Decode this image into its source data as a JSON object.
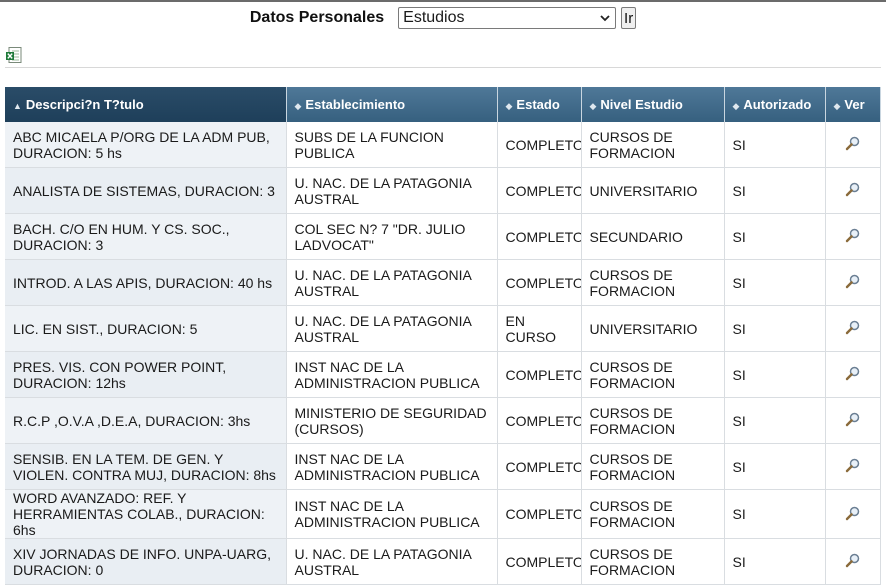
{
  "toolbar": {
    "label": "Datos Personales",
    "select_value": "Estudios",
    "go_label": "Ir"
  },
  "icons": {
    "export": "excel-icon",
    "view": "magnifier-icon",
    "dropdown": "chevron-down-icon",
    "sort": "sort-arrow-icon"
  },
  "colors": {
    "header_bg": "#3d6686",
    "header_active_bg": "#234560",
    "first_col_bg": "#e9eef3"
  },
  "table": {
    "columns": [
      {
        "label": "Descripci?n T?tulo",
        "sort": "▲"
      },
      {
        "label": "Establecimiento",
        "sort": "◆"
      },
      {
        "label": "Estado",
        "sort": "◆"
      },
      {
        "label": "Nivel Estudio",
        "sort": "◆"
      },
      {
        "label": "Autorizado",
        "sort": "◆"
      },
      {
        "label": "Ver",
        "sort": "◆"
      }
    ],
    "rows": [
      {
        "descripcion": "ABC MICAELA P/ORG DE LA ADM PUB, DURACION: 5 hs",
        "establecimiento": "SUBS DE LA FUNCION PUBLICA",
        "estado": "COMPLETO",
        "nivel": "CURSOS DE FORMACION",
        "autorizado": "SI"
      },
      {
        "descripcion": "ANALISTA DE SISTEMAS, DURACION: 3",
        "establecimiento": "U. NAC. DE LA PATAGONIA AUSTRAL",
        "estado": "COMPLETO",
        "nivel": "UNIVERSITARIO",
        "autorizado": "SI"
      },
      {
        "descripcion": "BACH. C/O EN HUM. Y CS. SOC., DURACION: 3",
        "establecimiento": "COL SEC N? 7 \"DR. JULIO LADVOCAT\"",
        "estado": "COMPLETO",
        "nivel": "SECUNDARIO",
        "autorizado": "SI"
      },
      {
        "descripcion": "INTROD. A LAS APIS, DURACION: 40 hs",
        "establecimiento": "U. NAC. DE LA PATAGONIA AUSTRAL",
        "estado": "COMPLETO",
        "nivel": "CURSOS DE FORMACION",
        "autorizado": "SI"
      },
      {
        "descripcion": "LIC. EN SIST., DURACION: 5",
        "establecimiento": "U. NAC. DE LA PATAGONIA AUSTRAL",
        "estado": "EN CURSO",
        "nivel": "UNIVERSITARIO",
        "autorizado": "SI"
      },
      {
        "descripcion": "PRES. VIS. CON POWER POINT, DURACION: 12hs",
        "establecimiento": "INST NAC DE LA ADMINISTRACION PUBLICA",
        "estado": "COMPLETO",
        "nivel": "CURSOS DE FORMACION",
        "autorizado": "SI"
      },
      {
        "descripcion": "R.C.P ,O.V.A ,D.E.A, DURACION: 3hs",
        "establecimiento": "MINISTERIO DE SEGURIDAD (CURSOS)",
        "estado": "COMPLETO",
        "nivel": "CURSOS DE FORMACION",
        "autorizado": "SI"
      },
      {
        "descripcion": "SENSIB. EN LA TEM. DE GEN. Y VIOLEN. CONTRA MUJ, DURACION: 8hs",
        "establecimiento": "INST NAC DE LA ADMINISTRACION PUBLICA",
        "estado": "COMPLETO",
        "nivel": "CURSOS DE FORMACION",
        "autorizado": "SI"
      },
      {
        "descripcion": "WORD AVANZADO: REF. Y HERRAMIENTAS COLAB., DURACION: 6hs",
        "establecimiento": "INST NAC DE LA ADMINISTRACION PUBLICA",
        "estado": "COMPLETO",
        "nivel": "CURSOS DE FORMACION",
        "autorizado": "SI"
      },
      {
        "descripcion": "XIV JORNADAS DE INFO. UNPA-UARG, DURACION: 0",
        "establecimiento": "U. NAC. DE LA PATAGONIA AUSTRAL",
        "estado": "COMPLETO",
        "nivel": "CURSOS DE FORMACION",
        "autorizado": "SI"
      }
    ]
  }
}
